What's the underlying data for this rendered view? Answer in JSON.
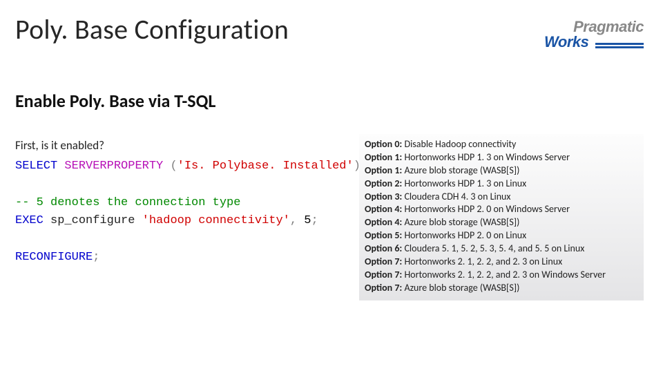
{
  "title": "Poly. Base Configuration",
  "logo": {
    "line1": "Pragmatic",
    "line2": "Works"
  },
  "section_title": "Enable Poly. Base via T-SQL",
  "subtext": "First, is it enabled?",
  "code": {
    "l1_kw": "SELECT",
    "l1_fn": "SERVERPROPERTY",
    "l1_lp": "(",
    "l1_str": "'Is. Polybase. Installed'",
    "l1_rp": ")",
    "l3_cmt": "-- 5 denotes the connection type",
    "l4_kw1": "EXEC",
    "l4_sp": " sp_configure ",
    "l4_str": "'hadoop connectivity'",
    "l4_comma": ",",
    "l4_num": " 5",
    "l4_semi": ";",
    "l6_kw": "RECONFIGURE",
    "l6_semi": ";"
  },
  "options": [
    {
      "k": "Option 0:",
      "v": " Disable Hadoop connectivity"
    },
    {
      "k": "Option 1:",
      "v": " Hortonworks HDP 1. 3 on Windows Server"
    },
    {
      "k": "Option 1:",
      "v": " Azure blob storage (WASB[S])"
    },
    {
      "k": "Option 2:",
      "v": " Hortonworks HDP 1. 3 on Linux"
    },
    {
      "k": "Option 3:",
      "v": " Cloudera CDH 4. 3 on Linux"
    },
    {
      "k": "Option 4:",
      "v": " Hortonworks HDP 2. 0 on Windows Server"
    },
    {
      "k": "Option 4:",
      "v": " Azure blob storage (WASB[S])"
    },
    {
      "k": "Option 5:",
      "v": " Hortonworks HDP 2. 0 on Linux"
    },
    {
      "k": "Option 6:",
      "v": " Cloudera 5. 1, 5. 2, 5. 3, 5. 4, and 5. 5 on Linux"
    },
    {
      "k": "Option 7:",
      "v": " Hortonworks 2. 1, 2. 2, and 2. 3 on Linux"
    },
    {
      "k": "Option 7:",
      "v": " Hortonworks 2. 1, 2. 2, and 2. 3 on Windows Server"
    },
    {
      "k": "Option 7:",
      "v": " Azure blob storage (WASB[S])"
    }
  ]
}
